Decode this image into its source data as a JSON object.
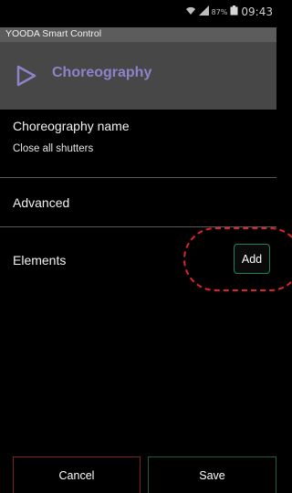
{
  "status_bar": {
    "battery_percent": "87%",
    "time": "09:43",
    "icons": [
      "wifi-icon",
      "signal-icon",
      "battery-icon"
    ]
  },
  "app": {
    "title": "YOODA Smart Control"
  },
  "action_bar": {
    "title": "Choreography",
    "icon": "play-icon"
  },
  "form": {
    "name_label": "Choreography name",
    "name_value": "Close all shutters",
    "advanced_label": "Advanced",
    "elements_label": "Elements",
    "add_label": "Add"
  },
  "footer": {
    "cancel_label": "Cancel",
    "save_label": "Save"
  },
  "colors": {
    "accent_purple": "#8f82c9",
    "add_border": "#1f7f66",
    "cancel_border": "#7a2525",
    "save_border": "#1e5c4a",
    "annotation_red": "#e0232b"
  }
}
